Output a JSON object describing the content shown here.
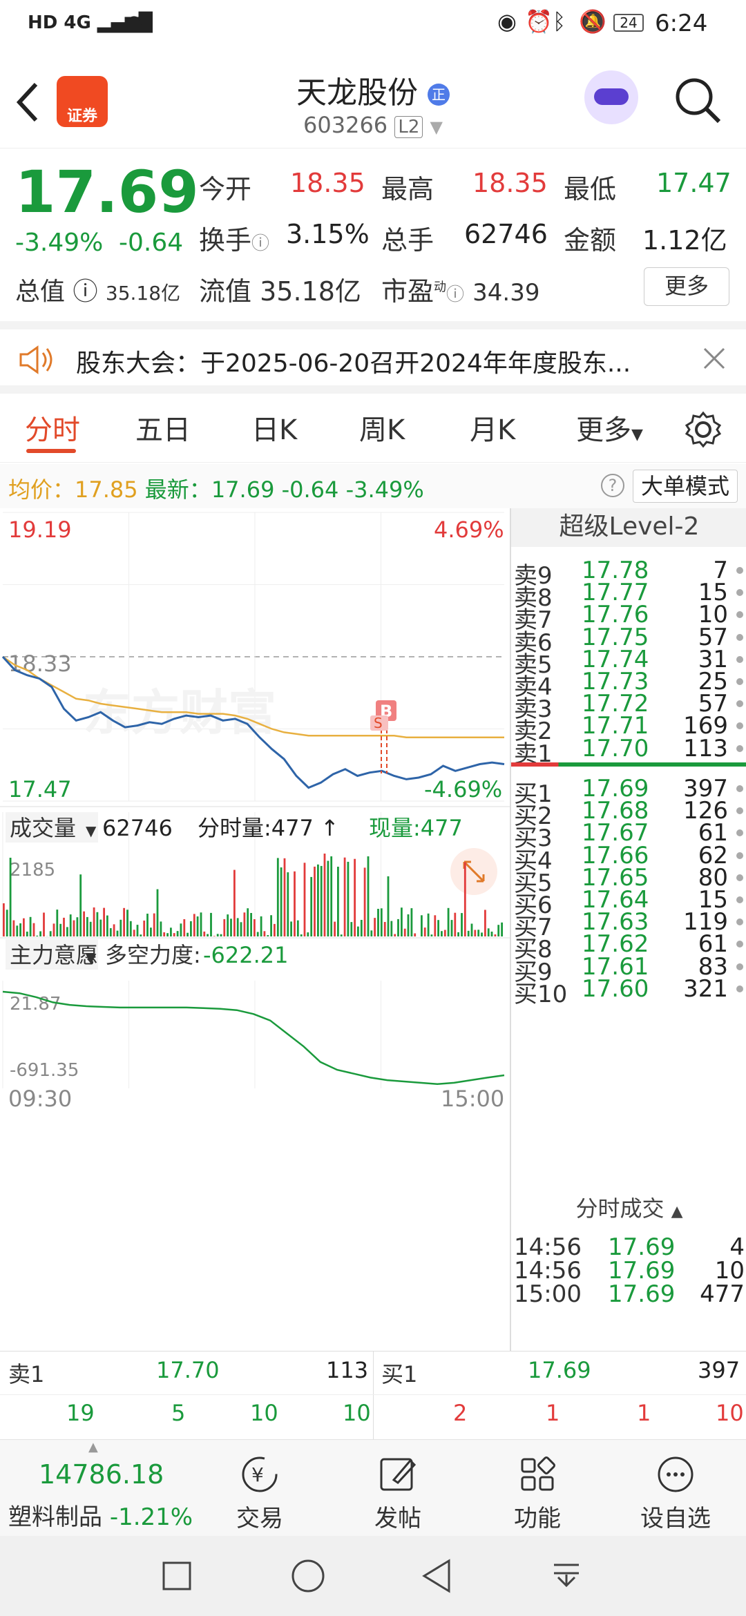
{
  "status": {
    "time": "6:24",
    "battery": "24",
    "network": "4G"
  },
  "header": {
    "back_icon": "chevron-left-icon",
    "app_badge": "证券",
    "title": "天龙股份",
    "title_badge": "正",
    "code": "603266",
    "level_badge": "L2"
  },
  "quote": {
    "price": "17.69",
    "change_pct": "-3.49%",
    "change": "-0.64",
    "open_label": "今开",
    "open": "18.35",
    "high_label": "最高",
    "high": "18.35",
    "low_label": "最低",
    "low": "17.47",
    "turnover_label": "换手",
    "turnover": "3.15%",
    "volume_label": "总手",
    "volume": "62746",
    "amount_label": "金额",
    "amount": "1.12亿",
    "mcap_label": "总值",
    "mcap": "35.18亿",
    "float_label": "流值",
    "float": "35.18亿",
    "pe_label": "市盈",
    "pe_sup": "动",
    "pe": "34.39",
    "more_button": "更多"
  },
  "notice": {
    "text": "股东大会：于2025-06-20召开2024年年度股东..."
  },
  "tabs": [
    "分时",
    "五日",
    "日K",
    "周K",
    "月K",
    "更多"
  ],
  "avgline": {
    "avg_label": "均价：",
    "avg": "17.85",
    "latest_label": "最新：",
    "latest": "17.69",
    "change": "-0.64",
    "change_pct": "-3.49%",
    "mode_button": "大单模式"
  },
  "chart": {
    "top_price": "19.19",
    "top_pct": "4.69%",
    "ref_price": "18.33",
    "bottom_price": "17.47",
    "bottom_pct": "-4.69%",
    "watermark": "东方财富",
    "marker_b": "B",
    "marker_s": "S",
    "volume_selector": "成交量",
    "volume_total": "62746",
    "tick_volume_label": "分时量:477",
    "current_volume_label": "现量:477",
    "volume_max": "2185",
    "fund_selector": "主力意愿",
    "fund_label": "多空力度:",
    "fund_value": "-622.21",
    "fund_top": "21.87",
    "fund_bottom": "-691.35",
    "time_start": "09:30",
    "time_end": "15:00"
  },
  "level2": {
    "title": "超级Level-2",
    "asks": [
      {
        "label": "卖9",
        "price": "17.78",
        "vol": "7"
      },
      {
        "label": "卖8",
        "price": "17.77",
        "vol": "15"
      },
      {
        "label": "卖7",
        "price": "17.76",
        "vol": "10"
      },
      {
        "label": "卖6",
        "price": "17.75",
        "vol": "57"
      },
      {
        "label": "卖5",
        "price": "17.74",
        "vol": "31"
      },
      {
        "label": "卖4",
        "price": "17.73",
        "vol": "25"
      },
      {
        "label": "卖3",
        "price": "17.72",
        "vol": "57"
      },
      {
        "label": "卖2",
        "price": "17.71",
        "vol": "169"
      },
      {
        "label": "卖1",
        "price": "17.70",
        "vol": "113"
      }
    ],
    "bids": [
      {
        "label": "买1",
        "price": "17.69",
        "vol": "397"
      },
      {
        "label": "买2",
        "price": "17.68",
        "vol": "126"
      },
      {
        "label": "买3",
        "price": "17.67",
        "vol": "61"
      },
      {
        "label": "买4",
        "price": "17.66",
        "vol": "62"
      },
      {
        "label": "买5",
        "price": "17.65",
        "vol": "80"
      },
      {
        "label": "买6",
        "price": "17.64",
        "vol": "15"
      },
      {
        "label": "买7",
        "price": "17.63",
        "vol": "119"
      },
      {
        "label": "买8",
        "price": "17.62",
        "vol": "61"
      },
      {
        "label": "买9",
        "price": "17.61",
        "vol": "83"
      },
      {
        "label": "买10",
        "price": "17.60",
        "vol": "321"
      }
    ],
    "ticks_title": "分时成交",
    "ticks": [
      {
        "time": "14:56",
        "price": "17.69",
        "vol": "4"
      },
      {
        "time": "14:56",
        "price": "17.69",
        "vol": "10"
      },
      {
        "time": "15:00",
        "price": "17.69",
        "vol": "477"
      }
    ]
  },
  "bottom": {
    "ask_label": "卖1",
    "ask_price": "17.70",
    "ask_vol": "113",
    "bid_label": "买1",
    "bid_price": "17.69",
    "bid_vol": "397",
    "left_queue": [
      "19",
      "5",
      "10",
      "10"
    ],
    "right_queue": [
      "2",
      "1",
      "1",
      "10"
    ]
  },
  "toolbar": {
    "index_value": "14786.18",
    "index_name": "塑料制品",
    "index_pct": "-1.21%",
    "trade": "交易",
    "post": "发帖",
    "function": "功能",
    "watch": "设自选"
  },
  "chart_data": {
    "type": "line",
    "series": [
      {
        "name": "",
        "values": [
          18.33,
          18.25,
          18.22,
          18.2,
          18.15,
          18.02,
          17.95,
          17.97,
          18.0,
          17.95,
          17.91,
          17.92,
          17.94,
          17.93,
          17.96,
          17.98,
          17.97,
          17.98,
          17.95,
          17.96,
          17.93,
          17.85,
          17.78,
          17.72,
          17.62,
          17.55,
          17.58,
          17.63,
          17.66,
          17.62,
          17.64,
          17.65,
          17.62,
          17.6,
          17.61,
          17.63,
          17.68,
          17.65,
          17.67,
          17.69,
          17.7,
          17.69
        ]
      },
      {
        "name": "均价",
        "values": [
          18.33,
          18.28,
          18.25,
          18.2,
          18.16,
          18.12,
          18.08,
          18.07,
          18.05,
          18.04,
          18.03,
          18.02,
          18.01,
          18.0,
          18.0,
          18.0,
          17.99,
          17.99,
          17.99,
          17.98,
          17.96,
          17.93,
          17.9,
          17.88,
          17.87,
          17.86,
          17.86,
          17.86,
          17.86,
          17.86,
          17.86,
          17.86,
          17.86,
          17.85,
          17.85,
          17.85,
          17.85,
          17.85,
          17.85,
          17.85,
          17.85,
          17.85
        ]
      }
    ],
    "ylim": [
      17.47,
      19.19
    ],
    "fund_series": [
      21.87,
      10,
      -20,
      -60,
      -80,
      -90,
      -95,
      -100,
      -100,
      -100,
      -100,
      -100,
      -105,
      -110,
      -120,
      -150,
      -200,
      -300,
      -400,
      -520,
      -580,
      -610,
      -640,
      -660,
      -670,
      -680,
      -690,
      -680,
      -660,
      -640,
      -622.21
    ],
    "volume_max": 2185
  }
}
